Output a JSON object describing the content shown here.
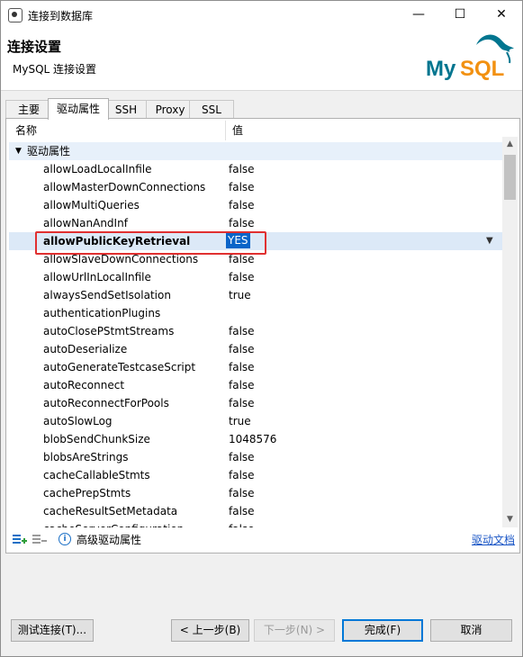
{
  "window": {
    "title": "连接到数据库"
  },
  "header": {
    "title": "连接设置",
    "subtitle": "MySQL 连接设置",
    "logo_text": "MySQL"
  },
  "tabs": [
    "主要",
    "驱动属性",
    "SSH",
    "Proxy",
    "SSL"
  ],
  "active_tab": "驱动属性",
  "table": {
    "col_name": "名称",
    "col_value": "值",
    "group": "驱动属性",
    "rows": [
      {
        "name": "allowLoadLocalInfile",
        "value": "false"
      },
      {
        "name": "allowMasterDownConnections",
        "value": "false"
      },
      {
        "name": "allowMultiQueries",
        "value": "false"
      },
      {
        "name": "allowNanAndInf",
        "value": "false"
      },
      {
        "name": "allowPublicKeyRetrieval",
        "value": "YES"
      },
      {
        "name": "allowSlaveDownConnections",
        "value": "false"
      },
      {
        "name": "allowUrlInLocalInfile",
        "value": "false"
      },
      {
        "name": "alwaysSendSetIsolation",
        "value": "true"
      },
      {
        "name": "authenticationPlugins",
        "value": ""
      },
      {
        "name": "autoClosePStmtStreams",
        "value": "false"
      },
      {
        "name": "autoDeserialize",
        "value": "false"
      },
      {
        "name": "autoGenerateTestcaseScript",
        "value": "false"
      },
      {
        "name": "autoReconnect",
        "value": "false"
      },
      {
        "name": "autoReconnectForPools",
        "value": "false"
      },
      {
        "name": "autoSlowLog",
        "value": "true"
      },
      {
        "name": "blobSendChunkSize",
        "value": "1048576"
      },
      {
        "name": "blobsAreStrings",
        "value": "false"
      },
      {
        "name": "cacheCallableStmts",
        "value": "false"
      },
      {
        "name": "cachePrepStmts",
        "value": "false"
      },
      {
        "name": "cacheResultSetMetadata",
        "value": "false"
      },
      {
        "name": "cacheServerConfiguration",
        "value": "false"
      }
    ]
  },
  "panel_toolbar": {
    "info_label": "高级驱动属性",
    "doc_link": "驱动文档"
  },
  "buttons": {
    "test": "测试连接(T)...",
    "back": "< 上一步(B)",
    "next": "下一步(N) >",
    "finish": "完成(F)",
    "cancel": "取消"
  },
  "colors": {
    "selection": "#0a64c8",
    "highlight_border": "#e03030",
    "link": "#1a56c6",
    "mysql_blue": "#00758f",
    "mysql_orange": "#f29111"
  }
}
